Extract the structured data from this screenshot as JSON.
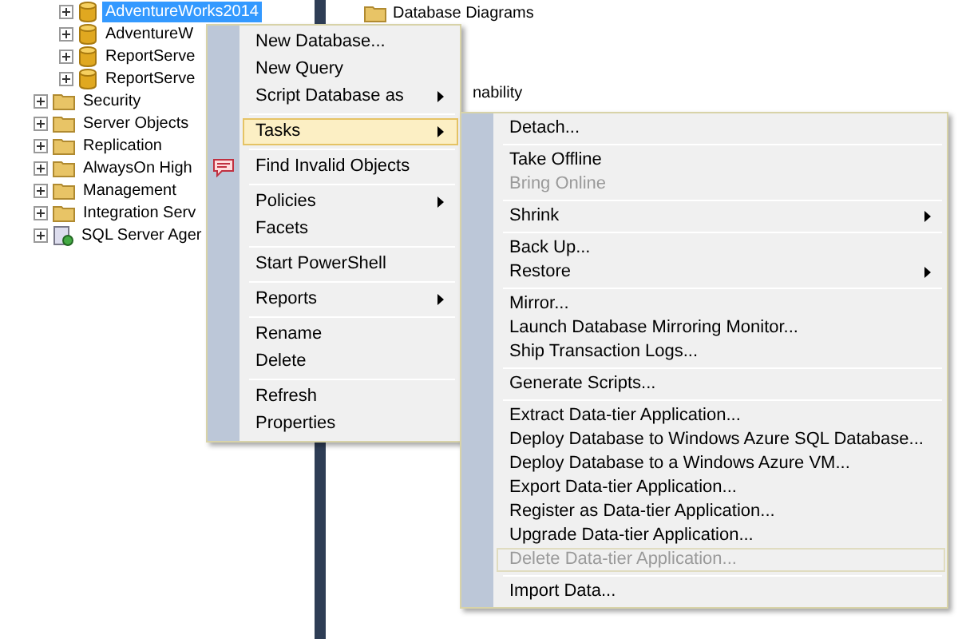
{
  "tree": [
    {
      "kind": "database",
      "label": "AdventureWorks2014",
      "selected": true
    },
    {
      "kind": "database",
      "label": "AdventureW",
      "selected": false
    },
    {
      "kind": "database",
      "label": "ReportServe",
      "selected": false
    },
    {
      "kind": "database",
      "label": "ReportServe",
      "selected": false
    },
    {
      "kind": "folder",
      "label": "Security",
      "selected": false
    },
    {
      "kind": "folder",
      "label": "Server Objects",
      "selected": false
    },
    {
      "kind": "folder",
      "label": "Replication",
      "selected": false
    },
    {
      "kind": "folder",
      "label": "AlwaysOn High",
      "selected": false
    },
    {
      "kind": "folder",
      "label": "Management",
      "selected": false
    },
    {
      "kind": "folder",
      "label": "Integration Serv",
      "selected": false
    },
    {
      "kind": "agent",
      "label": "SQL Server Ager",
      "selected": false
    }
  ],
  "right_panel": {
    "top_item": "Database Diagrams",
    "partial_text": "nability"
  },
  "context_menu": [
    {
      "kind": "item",
      "label": "New Database...",
      "submenu": false,
      "disabled": false,
      "selected": false
    },
    {
      "kind": "item",
      "label": "New Query",
      "submenu": false,
      "disabled": false,
      "selected": false
    },
    {
      "kind": "item",
      "label": "Script Database as",
      "submenu": true,
      "disabled": false,
      "selected": false
    },
    {
      "kind": "separator"
    },
    {
      "kind": "item",
      "label": "Tasks",
      "submenu": true,
      "disabled": false,
      "selected": true
    },
    {
      "kind": "separator"
    },
    {
      "kind": "icon_item",
      "label": "Find Invalid Objects",
      "submenu": false,
      "disabled": false,
      "selected": false
    },
    {
      "kind": "separator"
    },
    {
      "kind": "item",
      "label": "Policies",
      "submenu": true,
      "disabled": false,
      "selected": false
    },
    {
      "kind": "item",
      "label": "Facets",
      "submenu": false,
      "disabled": false,
      "selected": false
    },
    {
      "kind": "separator"
    },
    {
      "kind": "item",
      "label": "Start PowerShell",
      "submenu": false,
      "disabled": false,
      "selected": false
    },
    {
      "kind": "separator"
    },
    {
      "kind": "item",
      "label": "Reports",
      "submenu": true,
      "disabled": false,
      "selected": false
    },
    {
      "kind": "separator"
    },
    {
      "kind": "item",
      "label": "Rename",
      "submenu": false,
      "disabled": false,
      "selected": false
    },
    {
      "kind": "item",
      "label": "Delete",
      "submenu": false,
      "disabled": false,
      "selected": false
    },
    {
      "kind": "separator"
    },
    {
      "kind": "item",
      "label": "Refresh",
      "submenu": false,
      "disabled": false,
      "selected": false
    },
    {
      "kind": "item",
      "label": "Properties",
      "submenu": false,
      "disabled": false,
      "selected": false
    }
  ],
  "tasks_submenu": [
    {
      "kind": "item",
      "label": "Detach...",
      "submenu": false,
      "disabled": false,
      "selected": false
    },
    {
      "kind": "separator"
    },
    {
      "kind": "item",
      "label": "Take Offline",
      "submenu": false,
      "disabled": false,
      "selected": false
    },
    {
      "kind": "item",
      "label": "Bring Online",
      "submenu": false,
      "disabled": true,
      "selected": false
    },
    {
      "kind": "separator"
    },
    {
      "kind": "item",
      "label": "Shrink",
      "submenu": true,
      "disabled": false,
      "selected": false
    },
    {
      "kind": "separator"
    },
    {
      "kind": "item",
      "label": "Back Up...",
      "submenu": false,
      "disabled": false,
      "selected": false
    },
    {
      "kind": "item",
      "label": "Restore",
      "submenu": true,
      "disabled": false,
      "selected": false
    },
    {
      "kind": "separator"
    },
    {
      "kind": "item",
      "label": "Mirror...",
      "submenu": false,
      "disabled": false,
      "selected": false
    },
    {
      "kind": "item",
      "label": "Launch Database Mirroring Monitor...",
      "submenu": false,
      "disabled": false,
      "selected": false
    },
    {
      "kind": "item",
      "label": "Ship Transaction Logs...",
      "submenu": false,
      "disabled": false,
      "selected": false
    },
    {
      "kind": "separator"
    },
    {
      "kind": "item",
      "label": "Generate Scripts...",
      "submenu": false,
      "disabled": false,
      "selected": false
    },
    {
      "kind": "separator"
    },
    {
      "kind": "item",
      "label": "Extract Data-tier Application...",
      "submenu": false,
      "disabled": false,
      "selected": false
    },
    {
      "kind": "item",
      "label": "Deploy Database to Windows Azure SQL Database...",
      "submenu": false,
      "disabled": false,
      "selected": false
    },
    {
      "kind": "item",
      "label": "Deploy Database to a Windows Azure VM...",
      "submenu": false,
      "disabled": false,
      "selected": false
    },
    {
      "kind": "item",
      "label": "Export Data-tier Application...",
      "submenu": false,
      "disabled": false,
      "selected": false
    },
    {
      "kind": "item",
      "label": "Register as Data-tier Application...",
      "submenu": false,
      "disabled": false,
      "selected": false
    },
    {
      "kind": "item",
      "label": "Upgrade Data-tier Application...",
      "submenu": false,
      "disabled": false,
      "selected": false
    },
    {
      "kind": "item",
      "label": "Delete Data-tier Application...",
      "submenu": false,
      "disabled": true,
      "selected": true
    },
    {
      "kind": "separator"
    },
    {
      "kind": "item",
      "label": "Import Data...",
      "submenu": false,
      "disabled": false,
      "selected": false
    }
  ]
}
